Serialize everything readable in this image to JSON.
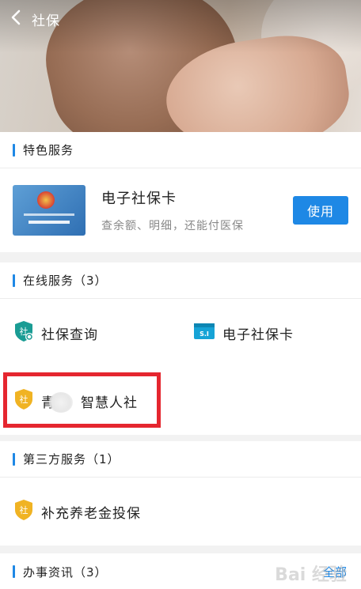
{
  "header": {
    "title": "社保"
  },
  "featured": {
    "section_title": "特色服务",
    "card": {
      "name": "电子社保卡",
      "description": "查余额、明细，还能付医保",
      "button_label": "使用",
      "image_icon": "social-security-card-image"
    }
  },
  "online": {
    "section_title": "在线服务（3）",
    "items": [
      {
        "label": "社保查询",
        "icon": "shield-social-icon"
      },
      {
        "label": "电子社保卡",
        "icon": "si-card-icon"
      },
      {
        "label": "青海智慧人社",
        "label_visible": "青     智慧人社",
        "icon": "shield-social-icon"
      }
    ]
  },
  "third_party": {
    "section_title": "第三方服务（1）",
    "items": [
      {
        "label": "补充养老金投保",
        "icon": "shield-social-icon"
      }
    ]
  },
  "news": {
    "section_title": "办事资讯（3）",
    "more_label": "全部"
  },
  "colors": {
    "accent": "#1e88e5",
    "highlight": "#e5262f",
    "teal_icon": "#1a9c94",
    "gold_icon": "#f0b323"
  },
  "watermark": "Bai 经验"
}
